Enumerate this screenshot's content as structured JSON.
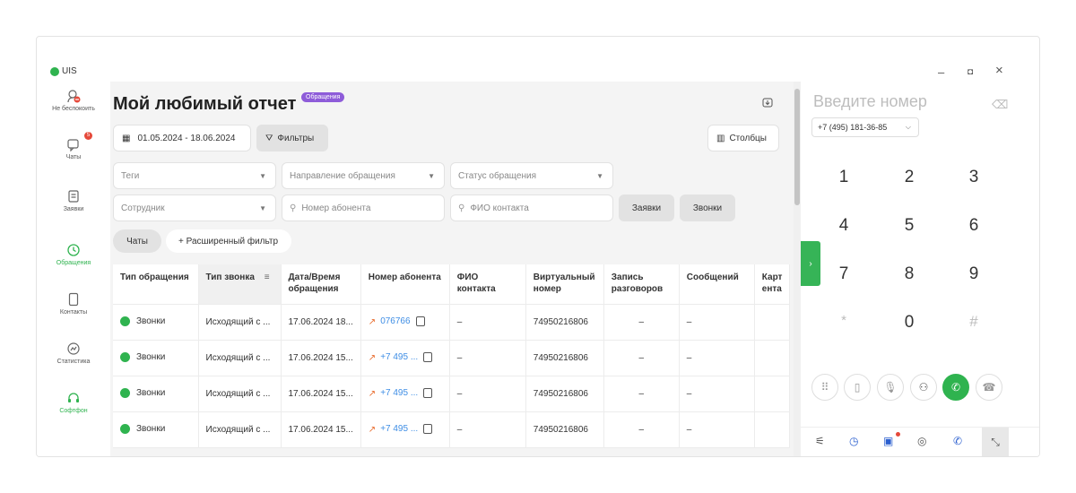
{
  "app": {
    "brand": "UIS",
    "minimize": "–",
    "restore": "◘",
    "close": "×"
  },
  "nav": [
    {
      "label": "Не беспокоить",
      "icon": "do-not-disturb-icon"
    },
    {
      "label": "Чаты",
      "icon": "chat-icon",
      "badge": "5"
    },
    {
      "label": "Заявки",
      "icon": "requests-icon"
    },
    {
      "label": "Обращения",
      "icon": "history-clock-icon",
      "active": true
    },
    {
      "label": "Контакты",
      "icon": "contacts-icon"
    },
    {
      "label": "Статистика",
      "icon": "statistics-icon"
    },
    {
      "label": "Софтфон",
      "icon": "headset-icon",
      "active": true
    }
  ],
  "header": {
    "title": "Мой любимый отчет",
    "badge": "Обращения"
  },
  "toolbar": {
    "date_range": "01.05.2024 - 18.06.2024",
    "filters": "Фильтры",
    "columns": "Столбцы"
  },
  "filters": {
    "tags": "Теги",
    "direction": "Направление обращения",
    "status": "Статус обращения",
    "employee": "Сотрудник",
    "subscriber_number": "Номер абонента",
    "contact_name": "ФИО контакта",
    "requests_btn": "Заявки",
    "calls_btn": "Звонки",
    "chats_chip": "Чаты",
    "advanced_filter": "+ Расширенный фильтр"
  },
  "table": {
    "headers": [
      "Тип обращения",
      "Тип звонка",
      "Дата/Время обращения",
      "Номер абонента",
      "ФИО контакта",
      "Виртуальный номер",
      "Запись разговоров",
      "Сообщений",
      "Карт ента"
    ],
    "rows": [
      [
        "Звонки",
        "Исходящий с ...",
        "17.06.2024 18...",
        "076766",
        "–",
        "74950216806",
        "–",
        "–",
        ""
      ],
      [
        "Звонки",
        "Исходящий с ...",
        "17.06.2024 15...",
        "+7 495 ...",
        "–",
        "74950216806",
        "–",
        "–",
        ""
      ],
      [
        "Звонки",
        "Исходящий с ...",
        "17.06.2024 15...",
        "+7 495 ...",
        "–",
        "74950216806",
        "–",
        "–",
        ""
      ],
      [
        "Звонки",
        "Исходящий с ...",
        "17.06.2024 15...",
        "+7 495 ...",
        "–",
        "74950216806",
        "–",
        "–",
        ""
      ]
    ]
  },
  "dialer": {
    "placeholder": "Введите номер",
    "caller_id": "+7 (495) 181-36-85",
    "keys": [
      "1",
      "2",
      "3",
      "4",
      "5",
      "6",
      "7",
      "8",
      "9",
      "*",
      "0",
      "#"
    ],
    "actions": [
      "dialpad-icon",
      "phone-device-icon",
      "mute-icon",
      "add-user-icon",
      "call-icon",
      "hangup-icon"
    ],
    "bottom": [
      "settings-icon",
      "history-icon",
      "chat-icon",
      "dnd-icon",
      "incoming-call-icon",
      "collapse-icon"
    ]
  },
  "colors": {
    "accent": "#2fb34f",
    "badge": "#8e5cd9",
    "link": "#3f8ee5",
    "alert": "#e5493a"
  }
}
